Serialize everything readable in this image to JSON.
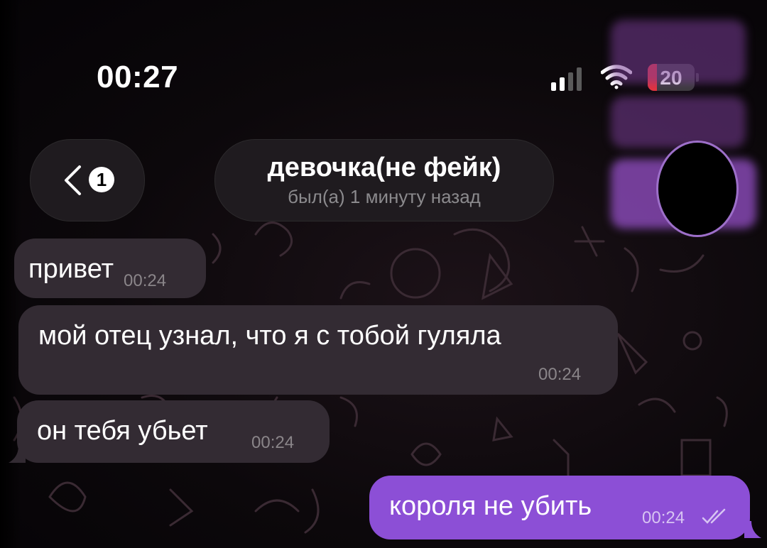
{
  "status_bar": {
    "time": "00:27",
    "battery": 20,
    "battery_label": "20",
    "signal_bars_active": 2,
    "icons": [
      "signal-icon",
      "wifi-icon",
      "battery-icon"
    ]
  },
  "header": {
    "back_icon": "chevron-left-icon",
    "unread_badge": "1",
    "title": "девочка(не фейк)",
    "subtitle": "был(а) 1 минуту назад"
  },
  "messages": [
    {
      "direction": "in",
      "text": "привет",
      "time": "00:24"
    },
    {
      "direction": "in",
      "text": "мой отец узнал, что я с тобой гуляла",
      "time": "00:24"
    },
    {
      "direction": "in",
      "text": "он тебя убьет",
      "time": "00:24"
    },
    {
      "direction": "out",
      "text": "короля не убить",
      "time": "00:24",
      "status_icon": "double-check-icon"
    }
  ],
  "colors": {
    "incoming_bubble": "#332b33",
    "outgoing_bubble": "#8c4fd6",
    "header_pill": "#1f1b1f",
    "battery_low": "#e8333b"
  }
}
